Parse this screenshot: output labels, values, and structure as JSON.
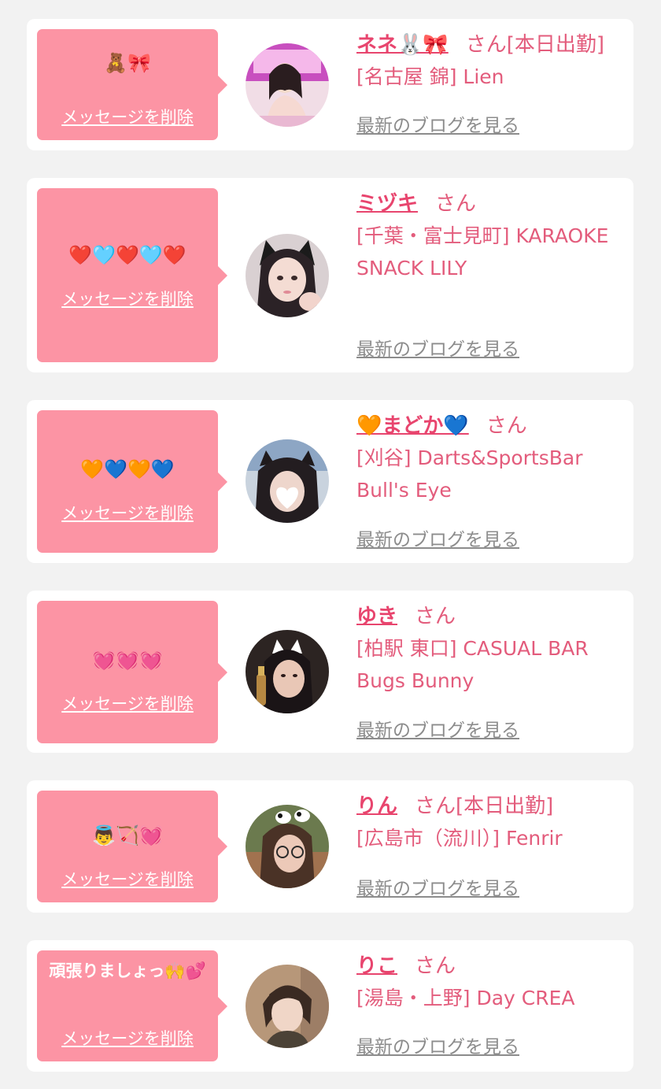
{
  "delete_label": "メッセージを削除",
  "blog_label": "最新のブログを見る",
  "san_suffix": "さん",
  "colors": {
    "background": "#f2f2f2",
    "card": "#ffffff",
    "bubble": "#fc94a4",
    "name": "#e8456e",
    "shop_text": "#e35c7c",
    "blog_link": "#8c8c8c"
  },
  "cards": [
    {
      "name": "ネネ🐰🎀",
      "suffix": "さん[本日出勤]",
      "shop": "[名古屋 錦] Lien",
      "message": "🧸🎀",
      "avatar_icon": "girl-photo-avatar"
    },
    {
      "name": "ミヅキ",
      "suffix": "さん",
      "shop": "[千葉・富士見町] KARAOKE SNACK LILY",
      "message": "❤️🩵❤️🩵❤️",
      "avatar_icon": "cat-ears-girl-avatar"
    },
    {
      "name": "🧡まどか💙",
      "suffix": "さん",
      "shop": "[刈谷] Darts&SportsBar Bull's Eye",
      "message": "🧡💙🧡💙",
      "avatar_icon": "heart-face-avatar"
    },
    {
      "name": "ゆき",
      "suffix": "さん",
      "shop": "[柏駅 東口] CASUAL BAR Bugs Bunny",
      "message": "💓💓💓",
      "avatar_icon": "selfie-girl-avatar"
    },
    {
      "name": "りん",
      "suffix": "さん[本日出勤]",
      "shop": "[広島市（流川）] Fenrir",
      "message": "👼🏹💓",
      "avatar_icon": "glasses-girl-avatar"
    },
    {
      "name": "りこ",
      "suffix": "さん",
      "shop": "[湯島・上野] Day CREA",
      "message": "頑張りましょっ🙌💕",
      "avatar_icon": "short-hair-girl-avatar"
    }
  ]
}
